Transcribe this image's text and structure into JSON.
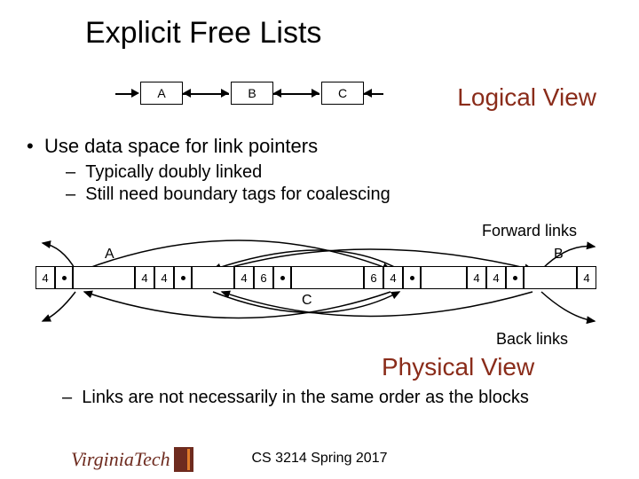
{
  "title": "Explicit Free Lists",
  "logical_view_label": "Logical View",
  "physical_view_label": "Physical View",
  "logical_nodes": [
    "A",
    "B",
    "C"
  ],
  "bullets": {
    "main": "Use data space for link pointers",
    "sub1": "Typically doubly linked",
    "sub2": "Still need boundary tags for coalescing"
  },
  "forward_label": "Forward links",
  "back_label": "Back links",
  "block_labels": {
    "a": "A",
    "b": "B",
    "c": "C"
  },
  "cells": [
    "4",
    "",
    "",
    "4",
    "4",
    "",
    "",
    "4",
    "6",
    "",
    "",
    "6",
    "4",
    "",
    "",
    "4",
    "4",
    "",
    "",
    "4"
  ],
  "final_bullet": "Links are not necessarily in the same order as the blocks",
  "footer": "CS 3214 Spring 2017",
  "logo_text": "VirginiaTech"
}
